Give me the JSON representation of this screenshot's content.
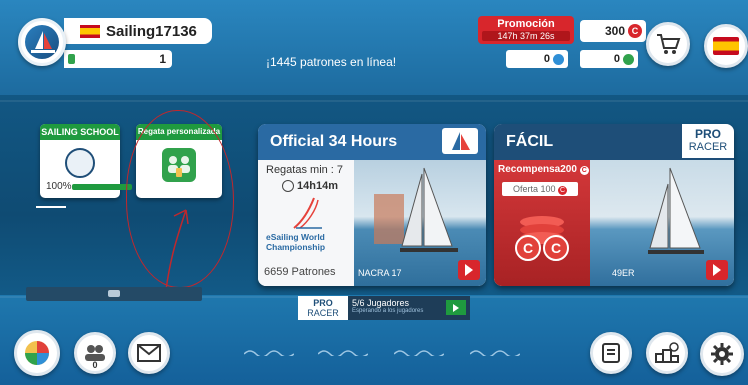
{
  "profile": {
    "username": "Sailing17136",
    "level": "1",
    "level_progress": 0.08
  },
  "online_text": "¡1445 patrones en línea!",
  "promo": {
    "title": "Promoción",
    "timer": "147h 37m 26s"
  },
  "currency": {
    "coins": "300",
    "resource_blue": "0",
    "resource_green": "0"
  },
  "school": {
    "header": "SAILING SCHOOL",
    "progress": "100%"
  },
  "custom_race": {
    "header": "Regata personalizada"
  },
  "card_official": {
    "title": "Official 34 Hours",
    "races_min": "Regatas min : 7",
    "duration": "14h14m",
    "brand_line1": "eSailing World",
    "brand_line2": "Championship",
    "patrons": "6659 Patrones",
    "boat": "NACRA 17"
  },
  "card_easy": {
    "title": "FÁCIL",
    "pro": "PRO",
    "racer": "RACER",
    "reward": "Recompensa",
    "reward_amount": "200",
    "offer": "Oferta 100",
    "boat": "49ER"
  },
  "pro_racer_players": {
    "pro": "PRO",
    "racer": "RACER",
    "players": "5/6 Jugadores",
    "waiting": "Esperando a los jugadores"
  },
  "friends_count": "0",
  "colors": {
    "accent_red": "#d8262c",
    "accent_green": "#1f9a3f",
    "header_blue": "#2a6aa3"
  }
}
